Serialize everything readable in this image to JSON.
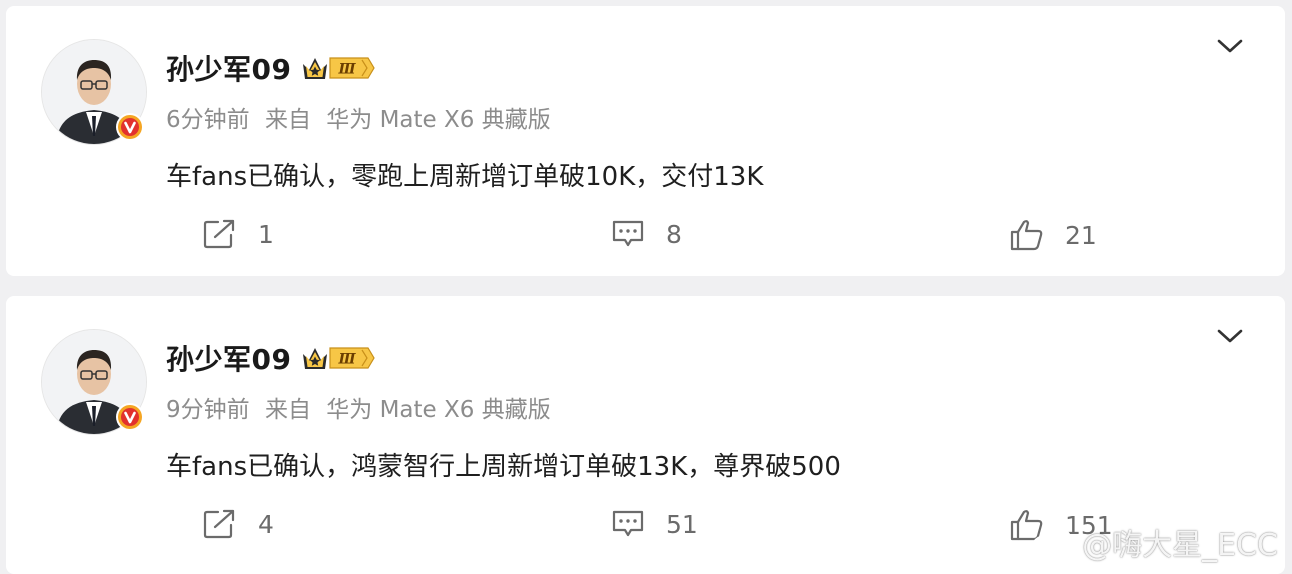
{
  "posts": [
    {
      "username": "孙少军09",
      "level_badge_text": "Ⅲ",
      "time": "6分钟前",
      "source_prefix": "来自",
      "source_device": "华为 Mate X6 典藏版",
      "content": "车fans已确认，零跑上周新增订单破10K，交付13K",
      "repost_count": "1",
      "comment_count": "8",
      "like_count": "21"
    },
    {
      "username": "孙少军09",
      "level_badge_text": "Ⅲ",
      "time": "9分钟前",
      "source_prefix": "来自",
      "source_device": "华为 Mate X6 典藏版",
      "content": "车fans已确认，鸿蒙智行上周新增订单破13K，尊界破500",
      "repost_count": "4",
      "comment_count": "51",
      "like_count": "151"
    }
  ],
  "watermark": {
    "text": "@嗨大星_ECC",
    "icon": "weibo-logo-icon"
  },
  "icons": {
    "verified": "verified-v-icon",
    "more": "chevron-down-icon",
    "repost": "repost-icon",
    "comment": "comment-icon",
    "like": "thumbs-up-icon"
  },
  "colors": {
    "verified_badge": "#f5a623",
    "level_badge": "#f7c646",
    "text_primary": "#1f1f1f",
    "text_secondary": "#8c8c8c",
    "background": "#f0f0f2"
  }
}
